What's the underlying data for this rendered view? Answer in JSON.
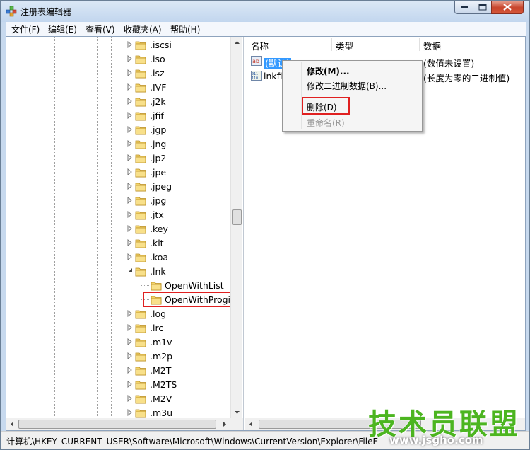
{
  "window": {
    "title": "注册表编辑器"
  },
  "menu": [
    "文件(F)",
    "编辑(E)",
    "查看(V)",
    "收藏夹(A)",
    "帮助(H)"
  ],
  "tree": {
    "items": [
      {
        "label": ".iscsi",
        "state": "collapsed"
      },
      {
        "label": ".iso",
        "state": "collapsed"
      },
      {
        "label": ".isz",
        "state": "collapsed"
      },
      {
        "label": ".IVF",
        "state": "collapsed"
      },
      {
        "label": ".j2k",
        "state": "collapsed"
      },
      {
        "label": ".jfif",
        "state": "collapsed"
      },
      {
        "label": ".jgp",
        "state": "collapsed"
      },
      {
        "label": ".jng",
        "state": "collapsed"
      },
      {
        "label": ".jp2",
        "state": "collapsed"
      },
      {
        "label": ".jpe",
        "state": "collapsed"
      },
      {
        "label": ".jpeg",
        "state": "collapsed"
      },
      {
        "label": ".jpg",
        "state": "collapsed"
      },
      {
        "label": ".jtx",
        "state": "collapsed"
      },
      {
        "label": ".key",
        "state": "collapsed"
      },
      {
        "label": ".klt",
        "state": "collapsed"
      },
      {
        "label": ".koa",
        "state": "collapsed"
      },
      {
        "label": ".lnk",
        "state": "expanded"
      },
      {
        "label": "OpenWithList",
        "state": "child"
      },
      {
        "label": "OpenWithProgid",
        "state": "child-highlight"
      },
      {
        "label": ".log",
        "state": "collapsed"
      },
      {
        "label": ".lrc",
        "state": "collapsed"
      },
      {
        "label": ".m1v",
        "state": "collapsed"
      },
      {
        "label": ".m2p",
        "state": "collapsed"
      },
      {
        "label": ".M2T",
        "state": "collapsed"
      },
      {
        "label": ".M2TS",
        "state": "collapsed"
      },
      {
        "label": ".M2V",
        "state": "collapsed"
      },
      {
        "label": ".m3u",
        "state": "collapsed"
      }
    ]
  },
  "list": {
    "columns": [
      "名称",
      "类型",
      "数据"
    ],
    "rows": [
      {
        "name": "(默认)",
        "data": "(数值未设置)",
        "selected": true
      },
      {
        "name": "lnkfil",
        "data": "(长度为零的二进制值)",
        "selected": false
      }
    ]
  },
  "context_menu": {
    "items": [
      {
        "label": "修改(M)...",
        "style": "bold"
      },
      {
        "label": "修改二进制数据(B)...",
        "style": "normal"
      },
      {
        "label": "删除(D)",
        "style": "highlight"
      },
      {
        "label": "重命名(R)",
        "style": "disabled"
      }
    ]
  },
  "status": {
    "path": "计算机\\HKEY_CURRENT_USER\\Software\\Microsoft\\Windows\\CurrentVersion\\Explorer\\FileE"
  },
  "watermark": {
    "title": "技术员联盟",
    "site": "www.jsgho.com"
  },
  "colors": {
    "selection": "#3399ff",
    "highlight_box": "#e02020",
    "watermark": "#4cb520"
  }
}
